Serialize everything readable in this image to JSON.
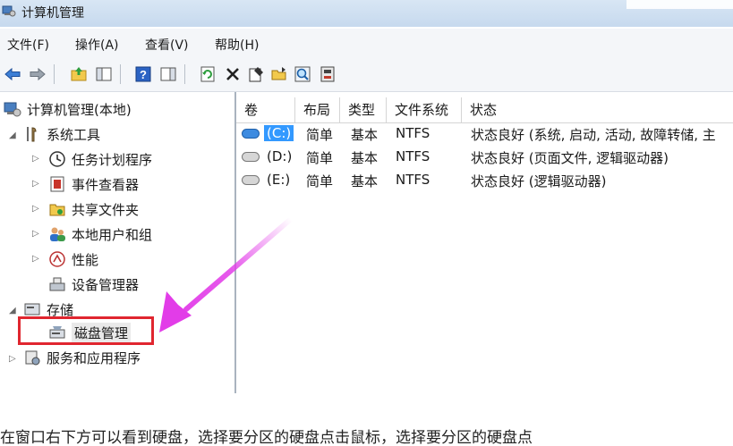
{
  "window": {
    "title": "计算机管理"
  },
  "menu": [
    {
      "id": "file",
      "label": "文件(F)"
    },
    {
      "id": "action",
      "label": "操作(A)"
    },
    {
      "id": "view",
      "label": "查看(V)"
    },
    {
      "id": "help",
      "label": "帮助(H)"
    }
  ],
  "toolbar": {
    "icons": [
      "back-arrow-icon",
      "forward-arrow-icon",
      "up-folder-icon",
      "show-hide-tree-icon",
      "help-icon",
      "action-pane-icon",
      "refresh-icon",
      "delete-icon",
      "properties-icon",
      "open-folder-icon",
      "search-icon",
      "disk-icon"
    ]
  },
  "tree": {
    "root": "计算机管理(本地)",
    "system_tools": "系统工具",
    "task_scheduler": "任务计划程序",
    "event_viewer": "事件查看器",
    "shared_folders": "共享文件夹",
    "local_users": "本地用户和组",
    "performance": "性能",
    "device_manager": "设备管理器",
    "storage": "存储",
    "disk_management": "磁盘管理",
    "services_apps": "服务和应用程序"
  },
  "list": {
    "columns": [
      "卷",
      "布局",
      "类型",
      "文件系统",
      "状态"
    ],
    "rows": [
      {
        "volume": "(C:)",
        "layout": "简单",
        "type": "基本",
        "fs": "NTFS",
        "status": "状态良好 (系统, 启动, 活动, 故障转储, 主"
      },
      {
        "volume": "(D:)",
        "layout": "简单",
        "type": "基本",
        "fs": "NTFS",
        "status": "状态良好 (页面文件, 逻辑驱动器)"
      },
      {
        "volume": "(E:)",
        "layout": "简单",
        "type": "基本",
        "fs": "NTFS",
        "status": "状态良好 (逻辑驱动器)"
      }
    ]
  },
  "caption": "在窗口右下方可以看到硬盘，选择要分区的硬盘点击鼠标，选择要分区的硬盘点",
  "colors": {
    "highlight_box": "#e0262f",
    "arrow": "#e23ce8",
    "selection": "#3399ff"
  }
}
